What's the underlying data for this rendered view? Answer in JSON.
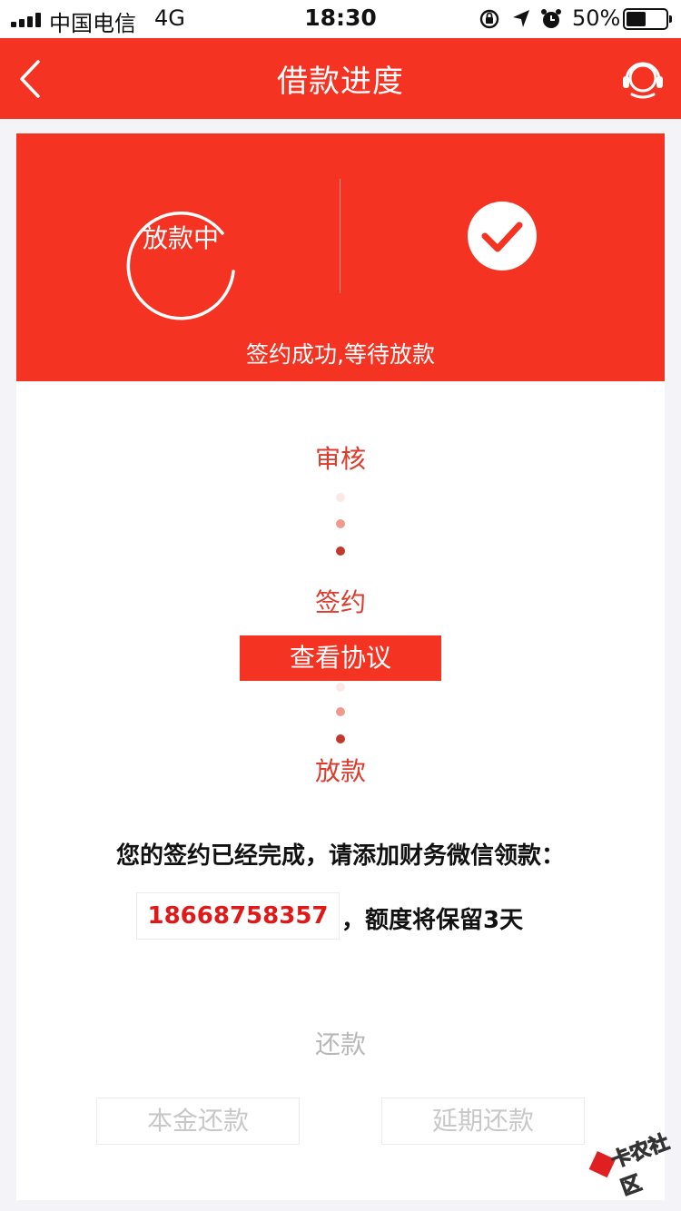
{
  "status_bar": {
    "carrier": "中国电信",
    "network": "4G",
    "time": "18:30",
    "battery": "50%",
    "battery_level": 0.5
  },
  "navbar": {
    "title": "借款进度",
    "back_icon": "chevron-left-icon",
    "support_icon": "headset-icon"
  },
  "hero": {
    "ring_label": "放款中",
    "status_text": "签约成功,等待放款",
    "check_icon": "check-circle-icon"
  },
  "steps": {
    "review": "审核",
    "sign": "签约",
    "view_agreement": "查看协议",
    "disburse": "放款"
  },
  "notice": {
    "message": "您的签约已经完成，请添加财务微信领款：",
    "phone": "18668758357",
    "retain": "，额度将保留3天"
  },
  "repay": {
    "title": "还款",
    "principal_button": "本金还款",
    "extend_button": "延期还款"
  },
  "watermark": "卡农社区",
  "colors": {
    "brand_red": "#f53322",
    "step_red": "#dd3b2c",
    "phone_red": "#e01818",
    "disabled_gray": "#c8c8c8"
  }
}
